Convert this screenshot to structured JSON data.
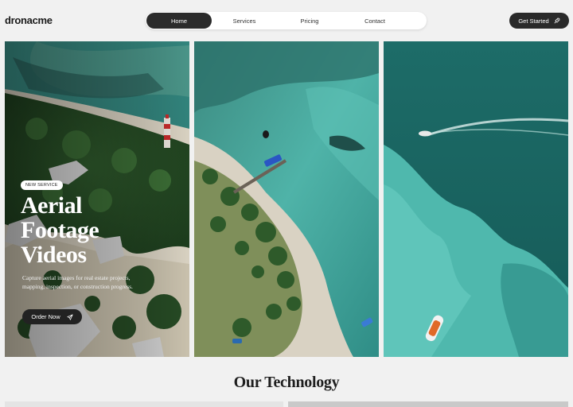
{
  "brand": {
    "logo": "dronacme"
  },
  "nav": {
    "items": [
      {
        "label": "Home",
        "active": true
      },
      {
        "label": "Services",
        "active": false
      },
      {
        "label": "Pricing",
        "active": false
      },
      {
        "label": "Contact",
        "active": false
      }
    ]
  },
  "header": {
    "cta_label": "Get Started",
    "cta_icon": "rocket-icon"
  },
  "hero": {
    "badge": "NEW SERVICE",
    "title_lines": [
      "Aerial",
      "Footage",
      "Videos"
    ],
    "description": "Capture aerial images for real estate projects, mapping, inspection, or construction progress.",
    "button_label": "Order Now",
    "button_icon": "paper-plane-icon"
  },
  "sections": {
    "technology_title": "Our Technology"
  },
  "colors": {
    "dark": "#2a2a2a",
    "background": "#f1f1f1",
    "sea": "#2e9a93",
    "deep_sea": "#166562",
    "forest": "#2f5a2c",
    "sand": "#d9d2c3"
  }
}
